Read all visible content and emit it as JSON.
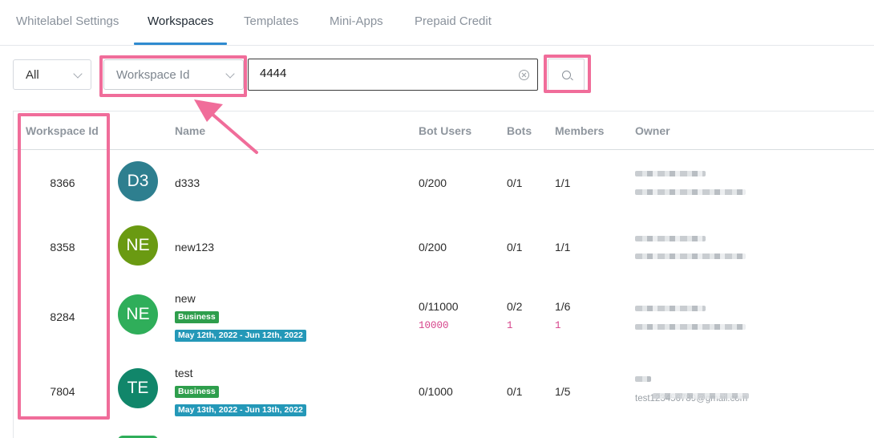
{
  "tabs": [
    {
      "label": "Whitelabel Settings",
      "active": false
    },
    {
      "label": "Workspaces",
      "active": true
    },
    {
      "label": "Templates",
      "active": false
    },
    {
      "label": "Mini-Apps",
      "active": false
    },
    {
      "label": "Prepaid Credit",
      "active": false
    }
  ],
  "filters": {
    "scope_value": "All",
    "field_value": "Workspace Id",
    "search_value": "4444"
  },
  "table": {
    "columns": [
      "Workspace Id",
      "Name",
      "Bot Users",
      "Bots",
      "Members",
      "Owner"
    ],
    "rows": [
      {
        "id": "8366",
        "initials": "D3",
        "avatar_color": "#2e7f8f",
        "name": "d333",
        "bot_users": "0/200",
        "bots": "0/1",
        "members": "1/1"
      },
      {
        "id": "8358",
        "initials": "NE",
        "avatar_color": "#6a9a12",
        "name": "new123",
        "bot_users": "0/200",
        "bots": "0/1",
        "members": "1/1"
      },
      {
        "id": "8284",
        "initials": "NE",
        "avatar_color": "#2fae5a",
        "name": "new",
        "plan": "Business",
        "period": "May 12th, 2022 - Jun 12th, 2022",
        "bot_users": "0/11000",
        "bot_users_extra": "10000",
        "bots": "0/2",
        "bots_extra": "1",
        "members": "1/6",
        "members_extra": "1"
      },
      {
        "id": "7804",
        "initials": "TE",
        "avatar_color": "#11866a",
        "name": "test",
        "plan": "Business",
        "period": "May 13th, 2022 - Jun 13th, 2022",
        "bot_users": "0/1000",
        "bots": "0/1",
        "members": "1/5",
        "owner_email": "test123456789@gmail.com"
      }
    ]
  },
  "colors": {
    "highlight": "#f06d9a",
    "active_tab": "#2f8bd0",
    "badge_green": "#2e9e4c",
    "badge_blue": "#2498b8"
  }
}
